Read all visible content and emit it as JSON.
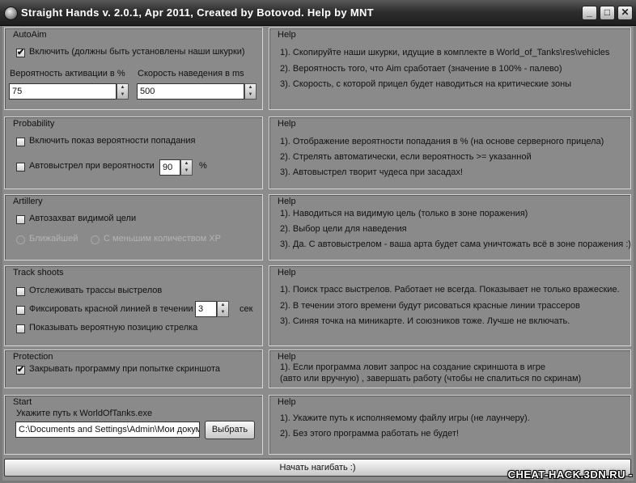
{
  "window": {
    "title": "Straight Hands v. 2.0.1, Apr 2011, Created by Botovod. Help by MNT",
    "minimize_label": "_",
    "maximize_label": "□",
    "close_label": "✕"
  },
  "icons": {
    "check_glyph": "✔",
    "spin_up": "▲",
    "spin_down": "▼"
  },
  "autoaim": {
    "title": "AutoAim",
    "enable_label": "Включить (должны быть установлены наши шкурки)",
    "enable_checked": true,
    "activation_label": "Вероятность активации в %",
    "activation_value": "75",
    "speed_label": "Скорость наведения в ms",
    "speed_value": "500"
  },
  "autoaim_help": {
    "title": "Help",
    "lines": [
      "1). Скопируйте наши шкурки, идущие в комплекте в World_of_Tanks\\res\\vehicles",
      "2). Вероятность того, что Aim сработает (значение в 100% - палево)",
      "3). Скорость, с которой прицел будет наводиться на критические зоны"
    ]
  },
  "probability": {
    "title": "Probability",
    "show_label": "Включить показ вероятности попадания",
    "show_checked": false,
    "autoshot_label": "Автовыстрел при вероятности",
    "autoshot_checked": false,
    "autoshot_value": "90",
    "percent_label": "%"
  },
  "probability_help": {
    "title": "Help",
    "lines": [
      "1). Отображение вероятности попадания в % (на основе серверного прицела)",
      "2). Стрелять автоматически, если вероятность >= указанной",
      "3). Автовыстрел творит чудеса при засадах!"
    ]
  },
  "artillery": {
    "title": "Artillery",
    "capture_label": "Автозахват видимой цели",
    "capture_checked": false,
    "nearest_label": "Ближайшей",
    "less_xp_label": "С меньшим количеством ХР"
  },
  "artillery_help": {
    "title": "Help",
    "lines": [
      "1). Наводиться на  видимую цель (только в  зоне поражения)",
      "2). Выбор цели для наведения",
      "3). Да. С автовыстрелом - ваша арта будет сама уничтожать всё в зоне поражения :)"
    ]
  },
  "track": {
    "title": "Track shoots",
    "trace_label": "Отслеживать трассы выстрелов",
    "trace_checked": false,
    "fix_label": "Фиксировать красной линией в течении",
    "fix_checked": false,
    "fix_value": "3",
    "sec_label": "сек",
    "position_label": "Показывать вероятную позицию стрелка",
    "position_checked": false
  },
  "track_help": {
    "title": "Help",
    "lines": [
      "1). Поиск трасс выстрелов. Работает не всегда. Показывает не только вражеские.",
      "2). В течении этого времени будут рисоваться красные линии трассеров",
      "3). Синяя точка на миникарте. И союзников тоже. Лучше не включать."
    ]
  },
  "protection": {
    "title": "Protection",
    "close_label": "Закрывать программу при попытке скриншота",
    "close_checked": true
  },
  "protection_help": {
    "title": "Help",
    "lines": [
      "1). Если программа ловит запрос на создание скриншота в игре",
      "(авто или вручную) , завершать работу (чтобы не спалиться по скринам)"
    ]
  },
  "start": {
    "title": "Start",
    "path_label": "Укажите путь к WorldOfTanks.exe",
    "path_value": "C:\\Documents and Settings\\Admin\\Мои докум",
    "browse_label": "Выбрать"
  },
  "start_help": {
    "title": "Help",
    "lines": [
      "1). Укажите путь к исполняемому файлу игры (не лаунчеру).",
      "2).  Без этого программа работать не будет!"
    ]
  },
  "start_button_label": "Начать нагибать :)",
  "watermark": "CHEAT-HACK.3DN.RU -"
}
